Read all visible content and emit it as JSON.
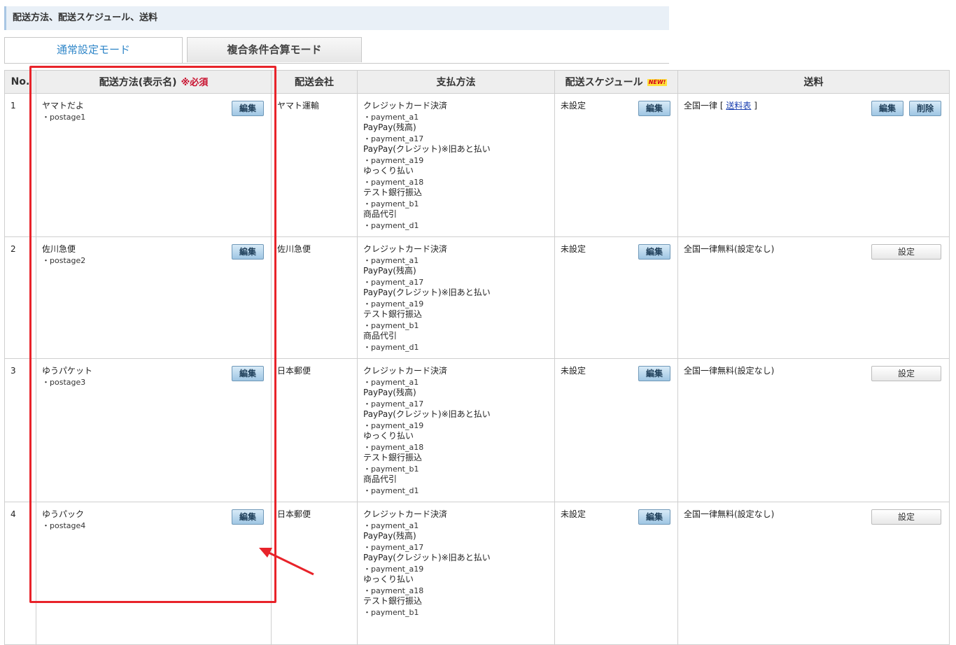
{
  "section_title": "配送方法、配送スケジュール、送料",
  "tabs": [
    {
      "label": "通常設定モード",
      "active": true
    },
    {
      "label": "複合条件合算モード",
      "active": false
    }
  ],
  "table": {
    "headers": {
      "no": "No.",
      "method": "配送方法(表示名)",
      "method_required": "※必須",
      "carrier": "配送会社",
      "payment": "支払方法",
      "schedule": "配送スケジュール",
      "schedule_badge": "NEW!",
      "fee": "送料"
    },
    "rows": [
      {
        "no": "1",
        "name": "ヤマトだよ",
        "code": "・postage1",
        "edit_label": "編集",
        "carrier": "ヤマト運輸",
        "payments": [
          {
            "name": "クレジットカード決済",
            "code": "・payment_a1"
          },
          {
            "name": "PayPay(残高)",
            "code": "・payment_a17"
          },
          {
            "name": "PayPay(クレジット)※旧あと払い",
            "code": "・payment_a19"
          },
          {
            "name": "ゆっくり払い",
            "code": "・payment_a18"
          },
          {
            "name": "テスト銀行振込",
            "code": "・payment_b1"
          },
          {
            "name": "商品代引",
            "code": "・payment_d1"
          }
        ],
        "schedule": "未設定",
        "schedule_edit_label": "編集",
        "fee_text": "全国一律",
        "fee_link_open": "[",
        "fee_link": "送料表",
        "fee_link_close": "]",
        "fee_edit_label": "編集",
        "fee_delete_label": "削除"
      },
      {
        "no": "2",
        "name": "佐川急便",
        "code": "・postage2",
        "edit_label": "編集",
        "carrier": "佐川急便",
        "payments": [
          {
            "name": "クレジットカード決済",
            "code": "・payment_a1"
          },
          {
            "name": "PayPay(残高)",
            "code": "・payment_a17"
          },
          {
            "name": "PayPay(クレジット)※旧あと払い",
            "code": "・payment_a19"
          },
          {
            "name": "テスト銀行振込",
            "code": "・payment_b1"
          },
          {
            "name": "商品代引",
            "code": "・payment_d1"
          }
        ],
        "schedule": "未設定",
        "schedule_edit_label": "編集",
        "fee_text": "全国一律無料(設定なし)",
        "fee_set_label": "設定"
      },
      {
        "no": "3",
        "name": "ゆうパケット",
        "code": "・postage3",
        "edit_label": "編集",
        "carrier": "日本郵便",
        "payments": [
          {
            "name": "クレジットカード決済",
            "code": "・payment_a1"
          },
          {
            "name": "PayPay(残高)",
            "code": "・payment_a17"
          },
          {
            "name": "PayPay(クレジット)※旧あと払い",
            "code": "・payment_a19"
          },
          {
            "name": "ゆっくり払い",
            "code": "・payment_a18"
          },
          {
            "name": "テスト銀行振込",
            "code": "・payment_b1"
          },
          {
            "name": "商品代引",
            "code": "・payment_d1"
          }
        ],
        "schedule": "未設定",
        "schedule_edit_label": "編集",
        "fee_text": "全国一律無料(設定なし)",
        "fee_set_label": "設定"
      },
      {
        "no": "4",
        "name": "ゆうパック",
        "code": "・postage4",
        "edit_label": "編集",
        "carrier": "日本郵便",
        "payments": [
          {
            "name": "クレジットカード決済",
            "code": "・payment_a1"
          },
          {
            "name": "PayPay(残高)",
            "code": "・payment_a17"
          },
          {
            "name": "PayPay(クレジット)※旧あと払い",
            "code": "・payment_a19"
          },
          {
            "name": "ゆっくり払い",
            "code": "・payment_a18"
          },
          {
            "name": "テスト銀行振込",
            "code": "・payment_b1"
          }
        ],
        "schedule": "未設定",
        "schedule_edit_label": "編集",
        "fee_text": "全国一律無料(設定なし)",
        "fee_set_label": "設定"
      }
    ]
  },
  "colors": {
    "highlight_box": "#e8232a",
    "tab_active_text": "#2f86c8",
    "required_text": "#c8102e",
    "header_bar_bg": "#e9f0f7"
  }
}
